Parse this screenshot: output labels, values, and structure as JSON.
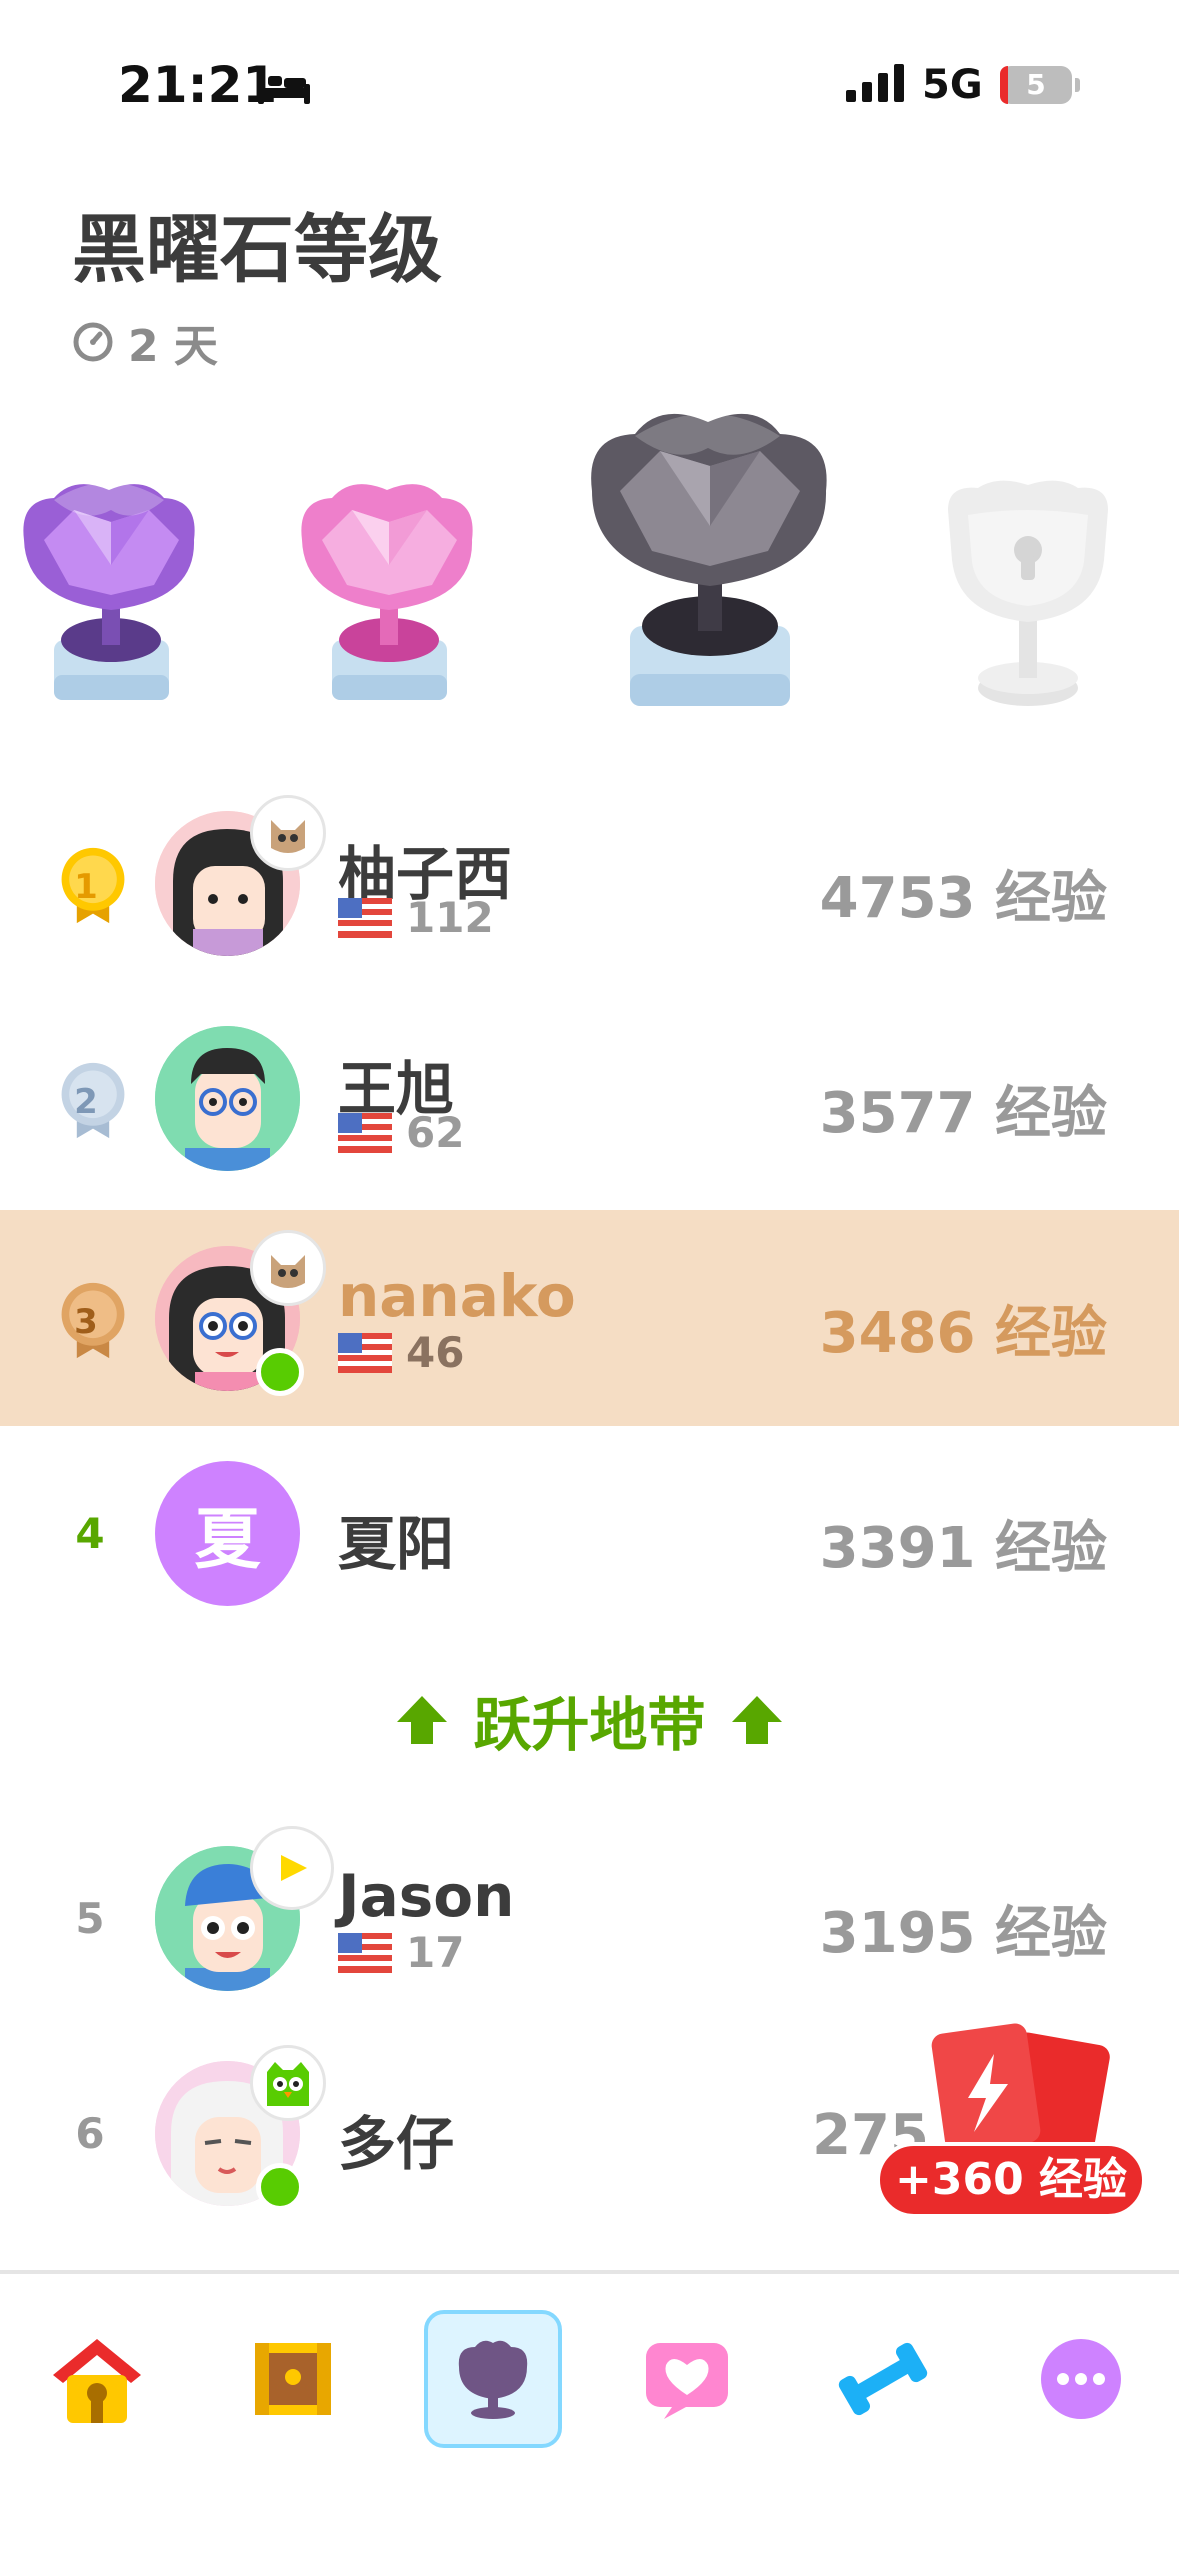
{
  "status_bar": {
    "time": "21:21",
    "network": "5G",
    "battery": "5"
  },
  "league": {
    "title": "黑曜石等级",
    "days_left": "2 天"
  },
  "trophies": [
    "amethyst",
    "pearl",
    "obsidian",
    "locked"
  ],
  "leaderboard": [
    {
      "rank": "1",
      "name": "柚子西",
      "streak": "112",
      "xp": "4753 经验"
    },
    {
      "rank": "2",
      "name": "王旭",
      "streak": "62",
      "xp": "3577 经验"
    },
    {
      "rank": "3",
      "name": "nanako",
      "streak": "46",
      "xp": "3486 经验"
    },
    {
      "rank": "4",
      "name": "夏阳",
      "avatar_letter": "夏",
      "xp": "3391 经验"
    },
    {
      "rank": "5",
      "name": "Jason",
      "streak": "17",
      "xp": "3195 经验"
    },
    {
      "rank": "6",
      "name": "多仔",
      "xp": "275"
    }
  ],
  "promotion_zone": {
    "label": "跃升地带"
  },
  "xp_boost": {
    "label": "+360 经验"
  },
  "tabs": [
    {
      "name": "home",
      "icon": "home-icon"
    },
    {
      "name": "chest",
      "icon": "chest-icon"
    },
    {
      "name": "leagues",
      "icon": "league-icon",
      "active": true
    },
    {
      "name": "friends",
      "icon": "heart-icon"
    },
    {
      "name": "practice",
      "icon": "dumbbell-icon"
    },
    {
      "name": "more",
      "icon": "more-icon"
    }
  ],
  "colors": {
    "accent_green": "#58a700",
    "highlight_row": "#f5ddc4",
    "xp_red": "#ea2b2b",
    "tab_active": "#ddf4ff"
  }
}
